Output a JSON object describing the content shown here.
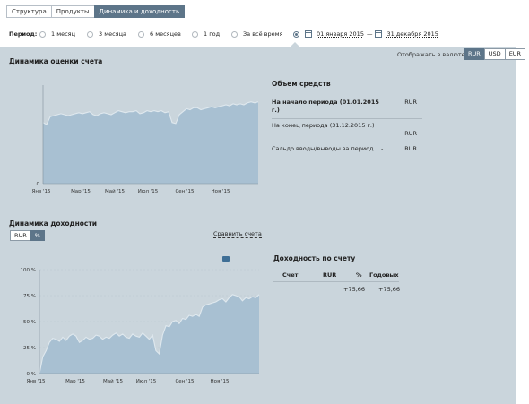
{
  "tabs": [
    {
      "label": "Структура",
      "active": false
    },
    {
      "label": "Продукты",
      "active": false
    },
    {
      "label": "Динамика и доходность",
      "active": true
    }
  ],
  "period": {
    "label": "Период:",
    "options": [
      "1 месяц",
      "3 месяца",
      "6 месяцев",
      "1 год",
      "За всё время"
    ],
    "date_from": "01 января 2015",
    "date_sep": "—",
    "date_to": "31 декабря 2015"
  },
  "currency": {
    "label": "Отображать в валюте:",
    "options": [
      "RUR",
      "USD",
      "EUR"
    ],
    "selected": "RUR"
  },
  "valuation": {
    "title": "Динамика оценки счета",
    "funds": {
      "title": "Объем средств",
      "row1_label": "На начало периода (01.01.2015 г.)",
      "row1_cur": "RUR",
      "row2_label": "На конец периода (31.12.2015 г.)",
      "row2_cur": "RUR",
      "row3_label": "Сальдо вводы/выводы за период",
      "row3_val": "-",
      "row3_cur": "RUR"
    }
  },
  "yield": {
    "title": "Динамика доходности",
    "toggle": [
      "RUR",
      "%"
    ],
    "toggle_selected": "%",
    "compare_label": "Сравнить счета",
    "table": {
      "title": "Доходность по счету",
      "headers": [
        "Счет",
        "RUR",
        "%",
        "Годовых"
      ],
      "row": [
        "",
        "",
        "+75,66",
        "+75,66"
      ]
    }
  },
  "chart_data": [
    {
      "type": "area",
      "title": "Динамика оценки счета",
      "x": [
        "Янв '15",
        "Мар '15",
        "Май '15",
        "Июл '15",
        "Сен '15",
        "Ноя '15"
      ],
      "yticks": [
        "0"
      ],
      "ylim": [
        0,
        null
      ],
      "series": [
        {
          "values": [
            0.62,
            0.6,
            0.68,
            0.69,
            0.7,
            0.71,
            0.7,
            0.69,
            0.7,
            0.71,
            0.72,
            0.71,
            0.72,
            0.73,
            0.7,
            0.69,
            0.71,
            0.72,
            0.71,
            0.7,
            0.72,
            0.74,
            0.73,
            0.72,
            0.73,
            0.73,
            0.74,
            0.71,
            0.72,
            0.74,
            0.73,
            0.74,
            0.73,
            0.74,
            0.72,
            0.73,
            0.62,
            0.61,
            0.7,
            0.73,
            0.76,
            0.75,
            0.77,
            0.77,
            0.75,
            0.76,
            0.77,
            0.78,
            0.77,
            0.78,
            0.79,
            0.8,
            0.79,
            0.81,
            0.8,
            0.81,
            0.8,
            0.82,
            0.83,
            0.82,
            0.83
          ]
        }
      ],
      "color": "#a8c0d2"
    },
    {
      "type": "area",
      "title": "Динамика доходности",
      "x": [
        "Янв '15",
        "Мар '15",
        "Май '15",
        "Июл '15",
        "Сен '15",
        "Ноя '15"
      ],
      "yticks": [
        "0 %",
        "25 %",
        "50 %",
        "75 %",
        "100 %"
      ],
      "ylim": [
        0,
        100
      ],
      "series": [
        {
          "values": [
            0,
            16,
            22,
            30,
            34,
            33,
            31,
            35,
            32,
            36,
            38,
            36,
            30,
            32,
            35,
            33,
            34,
            37,
            36,
            33,
            35,
            34,
            37,
            39,
            36,
            38,
            35,
            34,
            38,
            36,
            35,
            39,
            36,
            33,
            37,
            22,
            19,
            37,
            46,
            45,
            50,
            51,
            48,
            53,
            52,
            56,
            55,
            57,
            55,
            64,
            66,
            67,
            68,
            69,
            71,
            72,
            69,
            73,
            76,
            75,
            74,
            70,
            73,
            72,
            74,
            73,
            76
          ]
        }
      ],
      "color": "#a8c0d2"
    }
  ]
}
